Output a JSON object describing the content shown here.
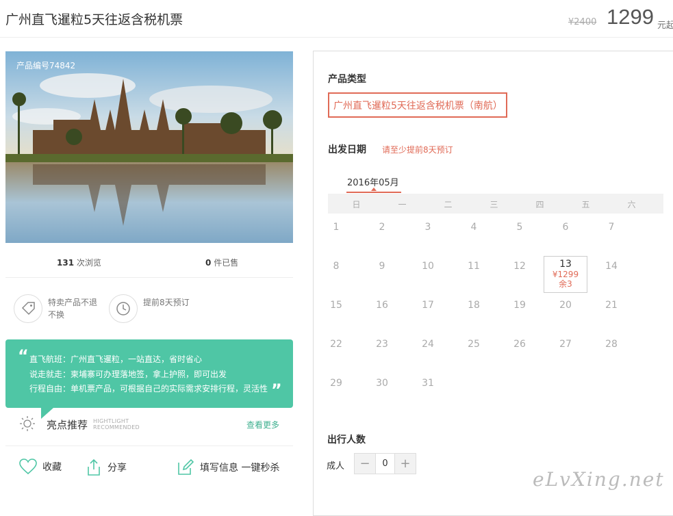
{
  "header": {
    "title": "广州直飞暹粒5天往返含税机票",
    "original_price": "¥2400",
    "price": "1299",
    "price_unit": "元起"
  },
  "hero": {
    "product_no": "产品编号74842",
    "image_subject": "Angkor Wat temple reflected in pond"
  },
  "stats": {
    "views_count": "131",
    "views_label": "次浏览",
    "sold_count": "0",
    "sold_label": "件已售"
  },
  "features": [
    {
      "icon": "tag-icon",
      "text": "特卖产品不退不换"
    },
    {
      "icon": "clock-icon",
      "text": "提前8天预订"
    }
  ],
  "highlights": {
    "lines": [
      "直飞航班：广州直飞暹粒，一站直达，省时省心",
      "说走就走：柬埔寨可办理落地签，拿上护照，即可出发",
      "行程自由：单机票产品，可根据自己的实际需求安排行程，灵活性"
    ],
    "title": "亮点推荐",
    "title_en_1": "HIGHTLIGHT",
    "title_en_2": "RECOMMENDED",
    "more": "查看更多"
  },
  "actions": {
    "favorite": "收藏",
    "share": "分享",
    "fill_info": "填写信息 一键秒杀"
  },
  "booking": {
    "product_type_label": "产品类型",
    "product_type_value": "广州直飞暹粒5天往返含税机票（南航）",
    "departure_label": "出发日期",
    "departure_notice": "请至少提前8天预订",
    "month": "2016年05月",
    "weekdays": [
      "日",
      "一",
      "二",
      "三",
      "四",
      "五",
      "六"
    ],
    "days": [
      "1",
      "2",
      "3",
      "4",
      "5",
      "6",
      "7",
      "8",
      "9",
      "10",
      "11",
      "12",
      "13",
      "14",
      "15",
      "16",
      "17",
      "18",
      "19",
      "20",
      "21",
      "22",
      "23",
      "24",
      "25",
      "26",
      "27",
      "28",
      "29",
      "30",
      "31"
    ],
    "available_day": {
      "day": "13",
      "price": "¥1299",
      "remaining": "余3"
    },
    "travelers_label": "出行人数",
    "adult_label": "成人",
    "adult_count": "0",
    "minus": "−",
    "plus": "+"
  },
  "watermark": "eLvXing.net",
  "colors": {
    "accent": "#e06a56",
    "green": "#4fc6a5"
  }
}
